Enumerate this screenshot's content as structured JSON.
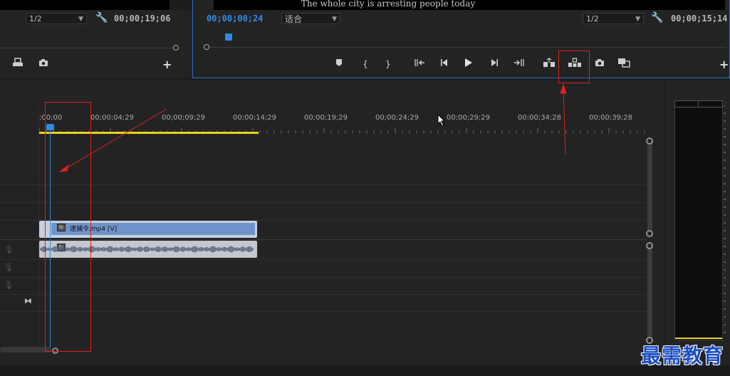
{
  "source_monitor": {
    "resolution": "1/2",
    "timecode": "00;00;19;06",
    "icons": [
      "wrench-icon",
      "export-frame-icon",
      "camera-icon",
      "add-icon"
    ]
  },
  "program_monitor": {
    "subtitle": "The whole city is arresting people today",
    "current_timecode": "00;00;00;24",
    "fit": "适合",
    "resolution": "1/2",
    "duration_timecode": "00;00;15;14",
    "transport_icons": [
      "marker-icon",
      "mark-in-icon",
      "mark-out-icon",
      "go-to-in-icon",
      "step-back-icon",
      "play-icon",
      "step-forward-icon",
      "go-to-out-icon",
      "lift-icon",
      "extract-icon",
      "camera-icon",
      "compare-icon",
      "add-icon"
    ],
    "accent_color": "#2d8ceb"
  },
  "timeline": {
    "ruler_labels": [
      ";00;00",
      "00;00;04;29",
      "00;00;09;29",
      "00;00;14;29",
      "00;00;19;29",
      "00;00;24;29",
      "00;00;29;29",
      "00;00;34;28",
      "00;00;39;28"
    ],
    "video_clip": {
      "label": "逮捕令.mp4 [V]",
      "fx": "fx"
    },
    "audio_clip": {
      "fx": "fx"
    },
    "work_area_color": "#e8d21d"
  },
  "watermark": "最需教育",
  "annotation_color": "#e02020"
}
